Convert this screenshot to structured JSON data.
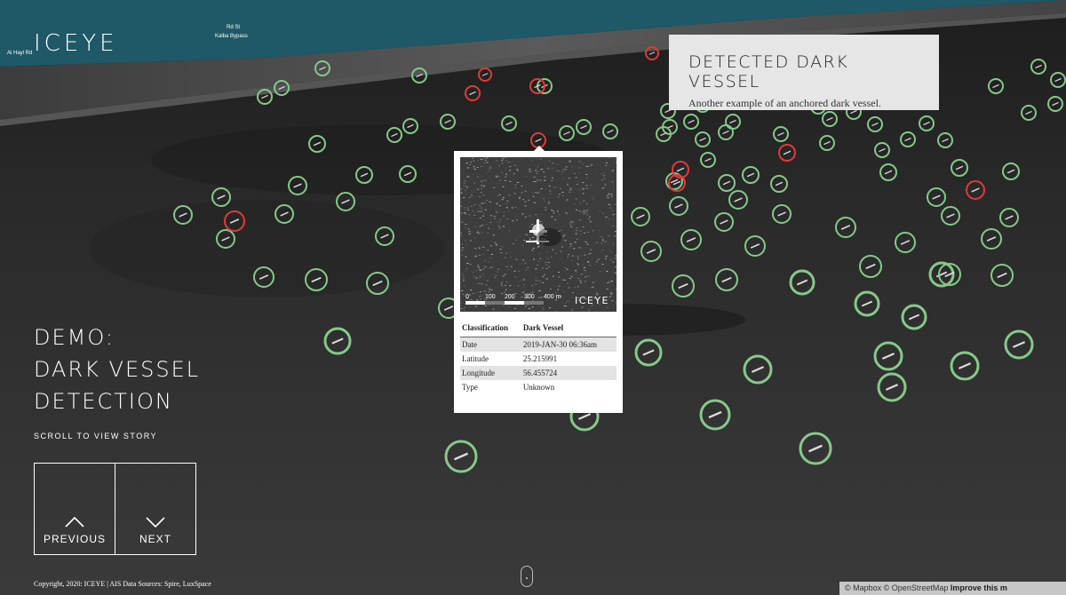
{
  "brand": {
    "logo_text": "ICEYE"
  },
  "map_labels": {
    "road_1": "Al Hayl Rd",
    "road_2": "Rd St",
    "road_3": "Kalba Bypass"
  },
  "story_card": {
    "title": "DETECTED DARK VESSEL",
    "subtitle": "Another example of an anchored dark vessel."
  },
  "demo": {
    "title_line1": "DEMO:",
    "title_line2": "DARK VESSEL",
    "title_line3": "DETECTION",
    "scroll_hint": "SCROLL TO VIEW STORY"
  },
  "nav": {
    "previous_label": "PREVIOUS",
    "next_label": "NEXT"
  },
  "popup": {
    "image_logo": "ICEYE",
    "scale_ticks": [
      "0",
      "100",
      "200",
      "300",
      "400 m"
    ],
    "header_left": "Classification",
    "header_right": "Dark Vessel",
    "rows": [
      {
        "label": "Date",
        "value": "2019-JAN-30 06:36am"
      },
      {
        "label": "Latitude",
        "value": "25.215991"
      },
      {
        "label": "Longitude",
        "value": "56.455724"
      },
      {
        "label": "Type",
        "value": "Unknown"
      }
    ]
  },
  "footer": {
    "copyright": "Copyright, 2020: ICEYE | AIS Data Sources: Spire, LuxSpace",
    "attribution_mapbox": "© Mapbox",
    "attribution_osm": "© OpenStreetMap",
    "attribution_improve": "Improve this m"
  },
  "colors": {
    "ais_vessel": "#86c98a",
    "dark_vessel": "#e03a3a",
    "sea": "#2b2b2b",
    "land_water": "#1e5a6a"
  }
}
